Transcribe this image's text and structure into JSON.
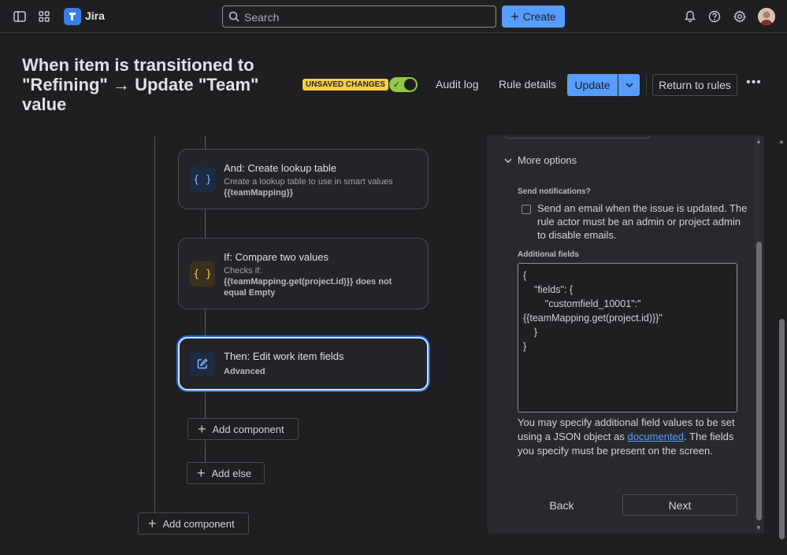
{
  "nav": {
    "app_name": "Jira",
    "search_placeholder": "Search",
    "create_label": "Create"
  },
  "header": {
    "title": "When item is transitioned to \"Refining\" → Update \"Team\" value",
    "unsaved_badge": "UNSAVED CHANGES",
    "rule_enabled": true,
    "audit_log": "Audit log",
    "rule_details": "Rule details",
    "update": "Update",
    "return_to_rules": "Return to rules",
    "more": "•••"
  },
  "flow": {
    "cards": [
      {
        "title": "And: Create lookup table",
        "subtitle": "Create a lookup table to use in smart values",
        "detail": "{{teamMapping}}",
        "icon": "braces-icon",
        "icon_glyph": "{ }"
      },
      {
        "title": "If: Compare two values",
        "subtitle": "Checks if:",
        "detail": "{{teamMapping.get(project.id)}} does not equal Empty",
        "icon": "braces-icon",
        "icon_glyph": "{ }"
      },
      {
        "title": "Then: Edit work item fields",
        "subtitle": "Advanced",
        "icon": "edit-icon"
      }
    ],
    "add_component_inner": "Add component",
    "add_else": "Add else",
    "add_component_outer": "Add component"
  },
  "panel": {
    "more_options": "More options",
    "send_notifications_label": "Send notifications?",
    "send_notifications_text": "Send an email when the issue is updated. The rule actor must be an admin or project admin to disable emails.",
    "send_notifications_checked": false,
    "additional_fields_label": "Additional fields",
    "additional_fields_value": "{\n    \"fields\": {\n        \"customfield_10001\":\"\n{{teamMapping.get(project.id)}}\"\n    }\n}",
    "help_before": "You may specify additional field values to be set using a JSON object as ",
    "help_link": "documented",
    "help_after": ". The fields you specify must be present on the screen.",
    "back": "Back",
    "next": "Next"
  },
  "colors": {
    "accent": "#579dff",
    "unsaved": "#f5cd47",
    "toggle_on": "#94c748",
    "background": "#1f1f21"
  }
}
